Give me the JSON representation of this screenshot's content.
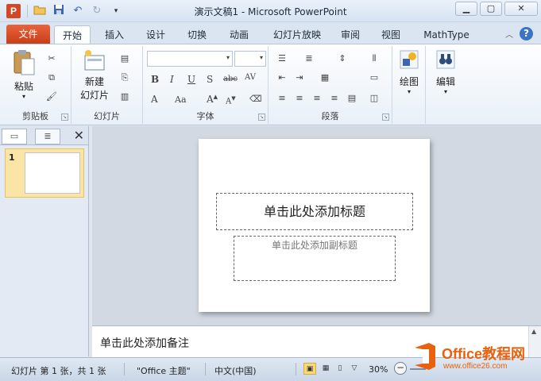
{
  "window": {
    "title": "演示文稿1 - Microsoft PowerPoint",
    "app_icon_letter": "P",
    "controls": [
      "minimize-icon",
      "maximize-icon",
      "close-icon"
    ]
  },
  "qat": {
    "icons": [
      "open-folder-icon",
      "save-icon",
      "undo-icon",
      "redo-icon",
      "customize-icon"
    ]
  },
  "tabs": {
    "file": "文件",
    "items": [
      "开始",
      "插入",
      "设计",
      "切换",
      "动画",
      "幻灯片放映",
      "审阅",
      "视图",
      "MathType"
    ],
    "active": "开始"
  },
  "ribbon": {
    "clipboard": {
      "label": "剪贴板",
      "paste": "粘贴"
    },
    "slides": {
      "label": "幻灯片",
      "new_slide_line1": "新建",
      "new_slide_line2": "幻灯片"
    },
    "font": {
      "label": "字体"
    },
    "paragraph": {
      "label": "段落"
    },
    "drawing": {
      "label": "绘图"
    },
    "editing": {
      "label": "编辑"
    }
  },
  "thumbnails": [
    {
      "number": "1"
    }
  ],
  "slide": {
    "title_placeholder": "单击此处添加标题",
    "subtitle_placeholder": "单击此处添加副标题"
  },
  "notes": {
    "placeholder": "单击此处添加备注"
  },
  "status": {
    "slide_info": "幻灯片 第 1 张，共 1 张",
    "theme": "\"Office 主题\"",
    "language": "中文(中国)",
    "zoom": "30%"
  },
  "watermark": {
    "brand": "Office教程网",
    "url": "www.office26.com"
  },
  "colors": {
    "file_tab": "#d24726",
    "accent": "#3a74c4",
    "watermark": "#e8610e"
  }
}
